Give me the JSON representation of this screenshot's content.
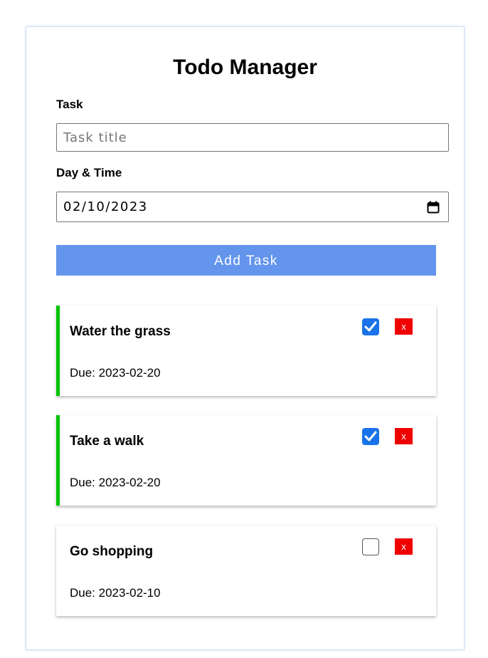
{
  "header": {
    "title": "Todo Manager"
  },
  "form": {
    "task_label": "Task",
    "task_placeholder": "Task title",
    "task_value": "",
    "datetime_label": "Day & Time",
    "datetime_value": "02/10/2023",
    "add_button_label": "Add Task"
  },
  "tasks": [
    {
      "title": "Water the grass",
      "due": "Due: 2023-02-20",
      "completed": true,
      "delete_label": "x"
    },
    {
      "title": "Take a walk",
      "due": "Due: 2023-02-20",
      "completed": true,
      "delete_label": "x"
    },
    {
      "title": "Go shopping",
      "due": "Due: 2023-02-10",
      "completed": false,
      "delete_label": "x"
    }
  ],
  "colors": {
    "accent": "#6495ed",
    "completed_border": "#00c400",
    "checkbox_checked": "#1a73e8",
    "delete_button": "#f00000"
  },
  "icons": {
    "calendar": "calendar-icon",
    "check": "checkmark-icon"
  }
}
